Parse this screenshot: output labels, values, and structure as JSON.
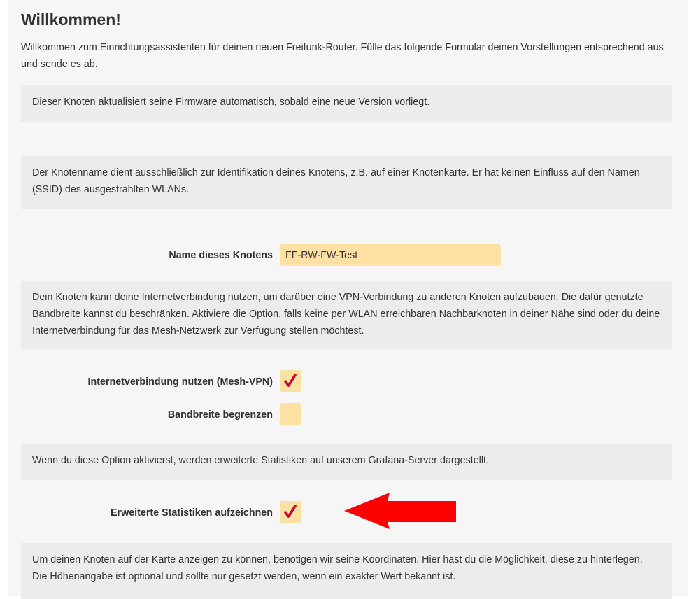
{
  "page": {
    "title": "Willkommen!",
    "intro": "Willkommen zum Einrichtungsassistenten für deinen neuen Freifunk-Router. Fülle das folgende Formular deinen Vorstellungen entsprechend aus und sende es ab."
  },
  "autoupdate": {
    "note": "Dieser Knoten aktualisiert seine Firmware automatisch, sobald eine neue Version vorliegt."
  },
  "hostname": {
    "note": "Der Knotenname dient ausschließlich zur Identifikation deines Knotens, z.B. auf einer Knotenkarte. Er hat keinen Einfluss auf den Namen (SSID) des ausgestrahlten WLANs.",
    "label": "Name dieses Knotens",
    "value": "FF-RW-FW-Test"
  },
  "meshvpn": {
    "note": "Dein Knoten kann deine Internetverbindung nutzen, um darüber eine VPN-Verbindung zu anderen Knoten aufzubauen. Die dafür genutzte Bandbreite kannst du beschränken. Aktiviere die Option, falls keine per WLAN erreichbaren Nachbarknoten in deiner Nähe sind oder du deine Internetverbindung für das Mesh-Netzwerk zur Verfügung stellen möchtest.",
    "enable_label": "Internetverbindung nutzen (Mesh-VPN)",
    "enable_checked": true,
    "limit_label": "Bandbreite begrenzen",
    "limit_checked": false
  },
  "statistics": {
    "note": "Wenn du diese Option aktivierst, werden erweiterte Statistiken auf unserem Grafana-Server dargestellt.",
    "label": "Erweiterte Statistiken aufzeichnen",
    "checked": true
  },
  "location": {
    "note": "Um deinen Knoten auf der Karte anzeigen zu können, benötigen wir seine Koordinaten. Hier hast du die Möglichkeit, diese zu hinterlegen. Die Höhenangabe ist optional und sollte nur gesetzt werden, wenn ein exakter Wert bekannt ist."
  },
  "colors": {
    "accent_input": "#ffe2a3",
    "check_mark": "#cc0033",
    "annotation_arrow": "#ff0000"
  },
  "icons": {
    "check": "check-mark-icon",
    "arrow": "red-arrow-left-icon"
  }
}
